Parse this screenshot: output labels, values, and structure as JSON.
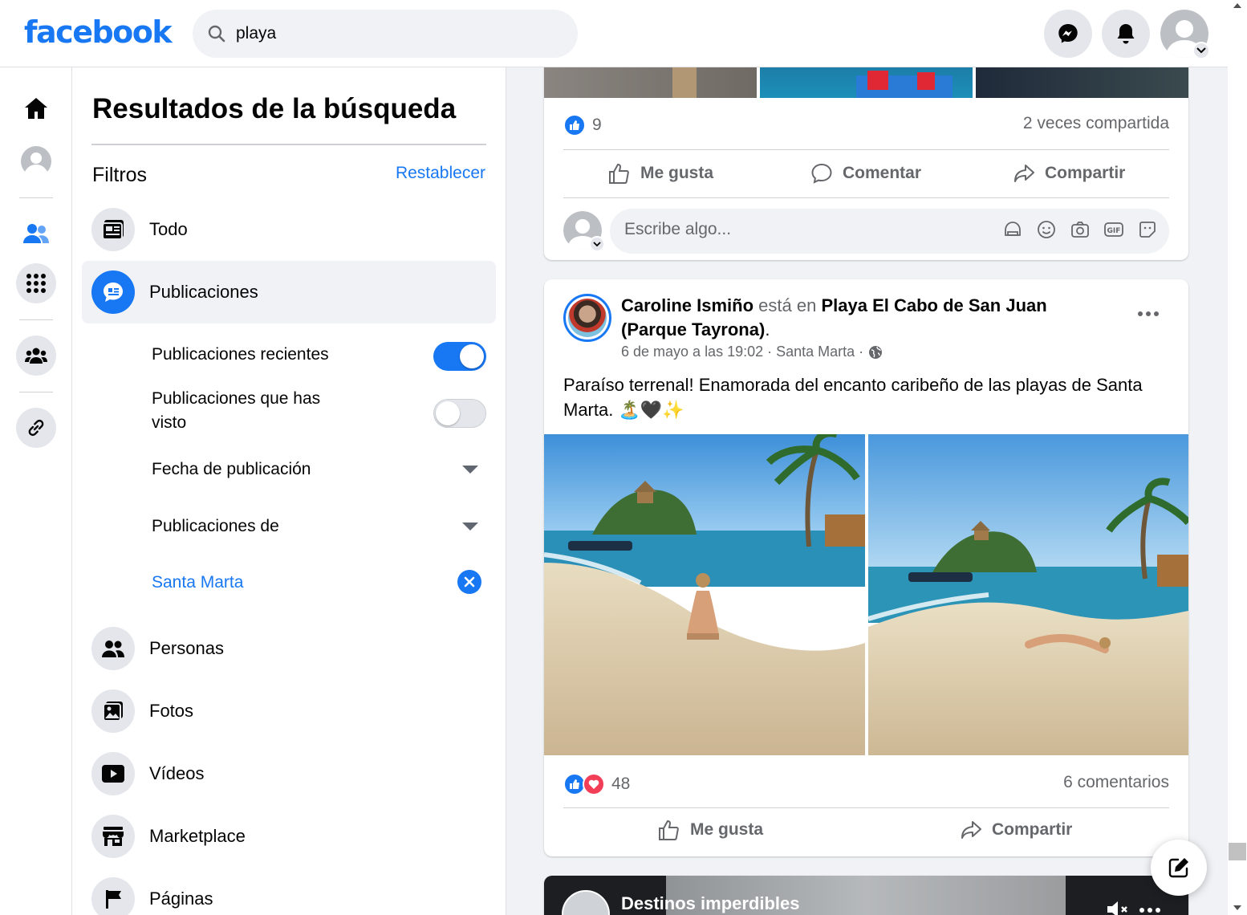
{
  "brand": "facebook",
  "search": {
    "value": "playa"
  },
  "panel": {
    "title": "Resultados de la búsqueda",
    "filters_label": "Filtros",
    "reset_label": "Restablecer",
    "categories": [
      {
        "label": "Todo"
      },
      {
        "label": "Publicaciones"
      },
      {
        "label": "Personas"
      },
      {
        "label": "Fotos"
      },
      {
        "label": "Vídeos"
      },
      {
        "label": "Marketplace"
      },
      {
        "label": "Páginas"
      }
    ],
    "subfilters": {
      "recent": "Publicaciones recientes",
      "recent_on": true,
      "seen_line1": "Publicaciones que has",
      "seen_line2": "visto",
      "seen_on": false,
      "date": "Fecha de publicación",
      "from": "Publicaciones de",
      "location": "Santa Marta"
    }
  },
  "post1": {
    "likes": "9",
    "shares": "2 veces compartida",
    "like_label": "Me gusta",
    "comment_label": "Comentar",
    "share_label": "Compartir",
    "composer_placeholder": "Escribe algo..."
  },
  "post2": {
    "author": "Caroline Ismiño",
    "is_at": "está en",
    "place": "Playa El Cabo de San Juan (Parque Tayrona)",
    "period": ".",
    "meta": "6 de mayo a las 19:02 · Santa Marta ·",
    "text": "Paraíso terrenal! Enamorada del encanto caribeño de las playas de Santa Marta. 🏝️🖤✨",
    "reactions": "48",
    "comments": "6 comentarios",
    "like_label": "Me gusta",
    "share_label": "Compartir"
  },
  "post3": {
    "title": "Destinos imperdibles"
  },
  "colors": {
    "accent": "#1877f2",
    "love": "#f33e58"
  }
}
